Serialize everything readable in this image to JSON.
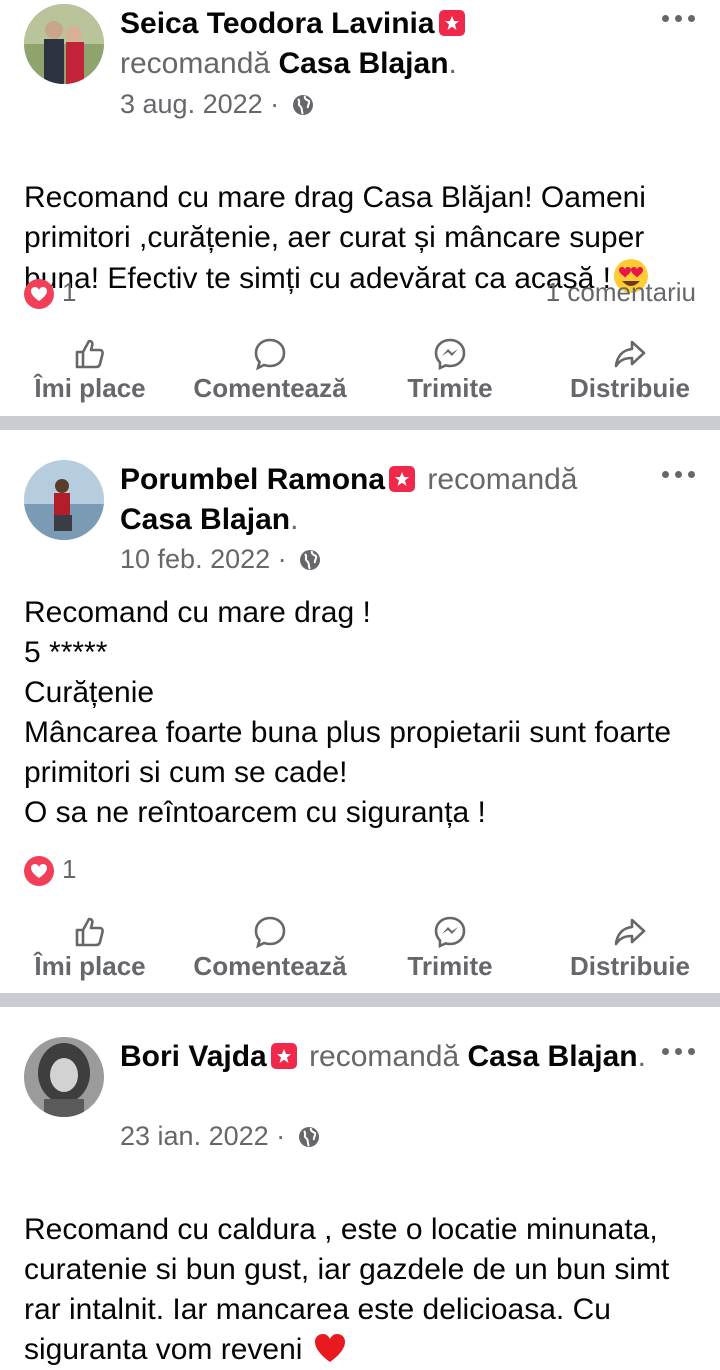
{
  "actions": {
    "like": "Îmi place",
    "comment": "Comentează",
    "send": "Trimite",
    "share": "Distribuie"
  },
  "posts": [
    {
      "author": "Seica Teodora Lavinia",
      "verb": "recomandă",
      "page": "Casa Blajan",
      "date": "3 aug. 2022",
      "text": "Recomand cu mare drag Casa Blăjan! Oameni primitori ,curățenie, aer curat și mâncare super buna! Efectiv te simți cu adevărat ca acasă !",
      "reactions": "1",
      "comments": "1 comentariu"
    },
    {
      "author": "Porumbel Ramona",
      "verb": "recomandă",
      "page": "Casa Blajan",
      "date": "10 feb. 2022",
      "text": "Recomand cu mare drag !\n 5 *****\nCurățenie\nMâncarea foarte buna plus propietarii sunt foarte primitori si cum se cade!\nO sa ne reîntoarcem  cu siguranța !",
      "reactions": "1"
    },
    {
      "author": "Bori Vajda",
      "verb": "recomandă",
      "page": "Casa Blajan",
      "date": "23 ian. 2022",
      "text": "Recomand cu caldura , este o locatie minunata, curatenie si bun gust, iar gazdele de un bun simt rar intalnit. Iar mancarea este delicioasa. Cu siguranta vom reveni"
    }
  ],
  "colors": {
    "badge": "#f02849",
    "heart": "#f33e58",
    "secondary_text": "#65676b",
    "divider": "#c9ccd1"
  }
}
